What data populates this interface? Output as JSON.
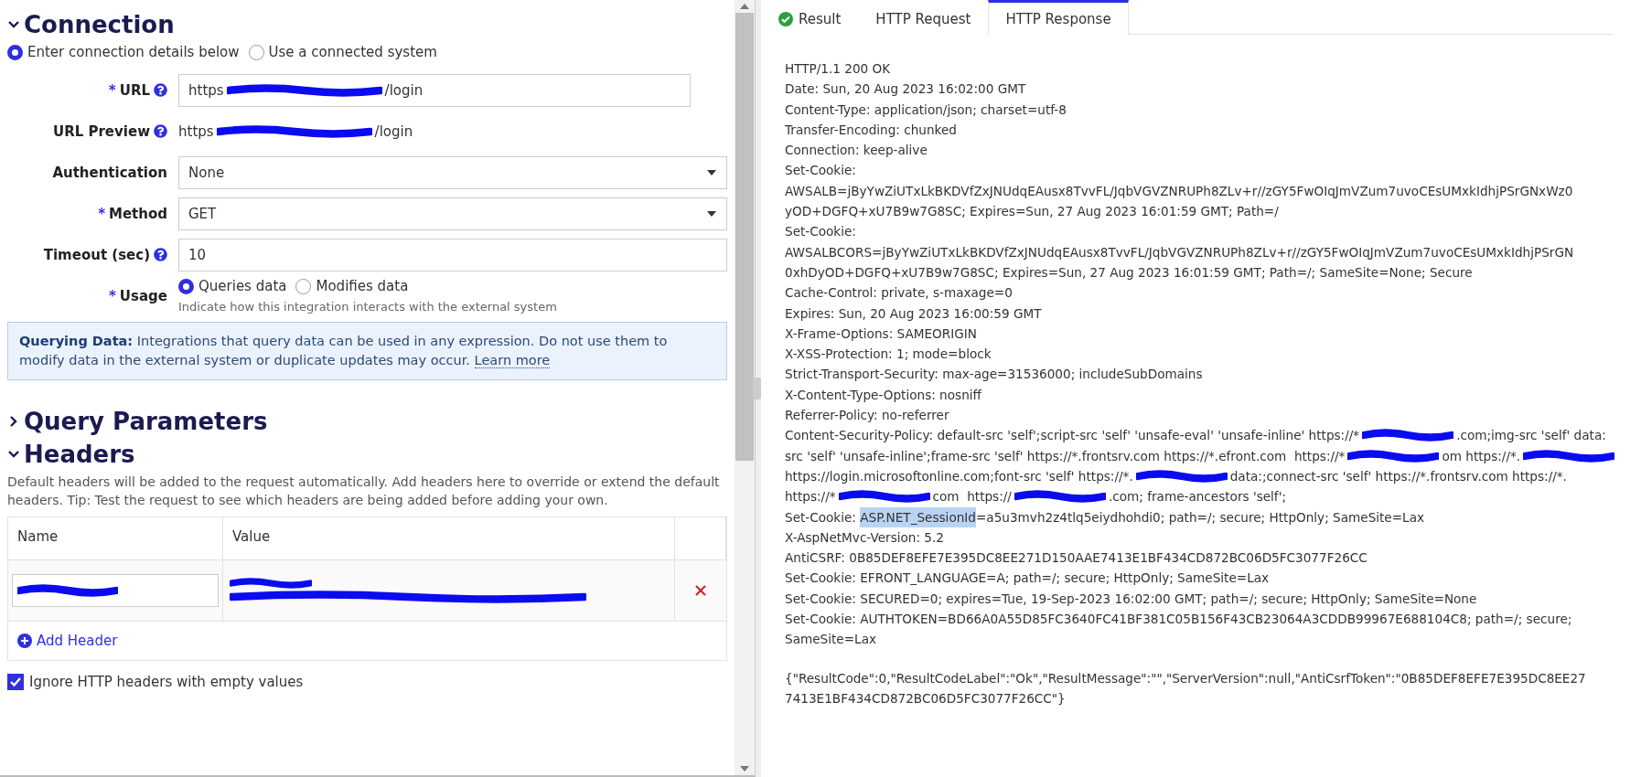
{
  "connection": {
    "title": "Connection",
    "expanded": true,
    "source_options": [
      {
        "label": "Enter connection details below",
        "selected": true
      },
      {
        "label": "Use a connected system",
        "selected": false
      }
    ],
    "fields": [
      {
        "kind": "input",
        "label": "URL",
        "required_mark": "*",
        "help": true,
        "value_parts": [
          "https",
          "/login"
        ]
      },
      {
        "kind": "text",
        "label": "URL Preview",
        "help": true,
        "value_parts": [
          "https",
          "/login"
        ]
      },
      {
        "kind": "select",
        "label": "Authentication",
        "help": false,
        "value": "None"
      },
      {
        "kind": "select",
        "label": "Method",
        "required_mark": "*",
        "help": false,
        "value": "GET"
      },
      {
        "kind": "input",
        "label": "Timeout (sec)",
        "help": true,
        "value_parts": [
          "10"
        ]
      },
      {
        "kind": "radio",
        "label": "Usage",
        "required_mark": "*",
        "help": false,
        "options": [
          {
            "label": "Queries data",
            "selected": true
          },
          {
            "label": "Modifies data",
            "selected": false
          }
        ],
        "hint": "Indicate how this integration interacts with the external system"
      }
    ],
    "info": {
      "title": "Querying Data:",
      "text": "Integrations that query data can be used in any expression. Do not use them to modify data in the external system or duplicate updates may occur.",
      "link": "Learn more"
    }
  },
  "query_parameters": {
    "title": "Query Parameters",
    "expanded": false
  },
  "headers": {
    "title": "Headers",
    "expanded": true,
    "description": "Default headers will be added to the request automatically. Add headers here to override or extend the default headers. Tip: Test the request to see which headers are being added before adding your own.",
    "columns": [
      "Name",
      "Value"
    ],
    "rows": [
      {
        "kind": "redacted"
      }
    ],
    "add_button": "Add Header",
    "ignore_empty": {
      "label": "Ignore HTTP headers with empty values",
      "checked": true
    }
  },
  "response": {
    "tabs": [
      {
        "label": "Result",
        "selected": false,
        "success": true
      },
      {
        "label": "HTTP Request",
        "selected": false
      },
      {
        "label": "HTTP Response",
        "selected": true
      }
    ],
    "lines": [
      "HTTP/1.1 200 OK",
      "Date: Sun, 20 Aug 2023 16:02:00 GMT",
      "Content-Type: application/json; charset=utf-8",
      "Transfer-Encoding: chunked",
      "Connection: keep-alive",
      "Set-Cookie:",
      "AWSALB=jByYwZiUTxLkBKDVfZxJNUdqEAusx8TvvFL/JqbVGVZNRUPh8ZLv+r//zGY5FwOIqJmVZum7uvoCEsUMxkIdhjPSrGNxWz0",
      "yOD+DGFQ+xU7B9w7G8SC; Expires=Sun, 27 Aug 2023 16:01:59 GMT; Path=/",
      "Set-Cookie:",
      "AWSALBCORS=jByYwZiUTxLkBKDVfZxJNUdqEAusx8TvvFL/JqbVGVZNRUPh8ZLv+r//zGY5FwOIqJmVZum7uvoCEsUMxkIdhjPSrGN",
      "0xhDyOD+DGFQ+xU7B9w7G8SC; Expires=Sun, 27 Aug 2023 16:01:59 GMT; Path=/; SameSite=None; Secure",
      "Cache-Control: private, s-maxage=0",
      "Expires: Sun, 20 Aug 2023 16:00:59 GMT",
      "X-Frame-Options: SAMEORIGIN",
      "X-XSS-Protection: 1; mode=block",
      "Strict-Transport-Security: max-age=31536000; includeSubDomains",
      "X-Content-Type-Options: nosniff",
      "Referrer-Policy: no-referrer",
      {
        "parts": [
          "Content-Security-Policy: default-src 'self';script-src 'self' 'unsafe-eval' 'unsafe-inline' https://*",
          {
            "kind": "redaction"
          },
          ".com;img-src 'self' data:"
        ]
      },
      {
        "parts": [
          "src 'self' 'unsafe-inline';frame-src 'self' https://*.frontsrv.com https://*.efront.com  https://*",
          {
            "kind": "redaction"
          },
          "om https://*.",
          {
            "kind": "redaction"
          }
        ]
      },
      {
        "parts": [
          "https://login.microsoftonline.com;font-src 'self' https://*.",
          {
            "kind": "redaction"
          },
          "data:;connect-src 'self' https://*.frontsrv.com https://*."
        ]
      },
      {
        "parts": [
          "https://*",
          {
            "kind": "redaction"
          },
          "com  https://",
          {
            "kind": "redaction"
          },
          ".com; frame-ancestors 'self';"
        ]
      },
      {
        "parts": [
          "Set-Cookie: ",
          {
            "kind": "highlight",
            "text": "ASP.NET_SessionId"
          },
          "=a5u3mvh2z4tlq5eiydhohdi0; path=/; secure; HttpOnly; SameSite=Lax"
        ]
      },
      "X-AspNetMvc-Version: 5.2",
      "AntiCSRF: 0B85DEF8EFE7E395DC8EE271D150AAE7413E1BF434CD872BC06D5FC3077F26CC",
      "Set-Cookie: EFRONT_LANGUAGE=A; path=/; secure; HttpOnly; SameSite=Lax",
      "Set-Cookie: SECURED=0; expires=Tue, 19-Sep-2023 16:02:00 GMT; path=/; secure; HttpOnly; SameSite=None",
      "Set-Cookie: AUTHTOKEN=BD66A0A55D85FC3640FC41BF381C05B156F43CB23064A3CDDB99967E688104C8; path=/; secure;",
      "SameSite=Lax"
    ],
    "body_lines": [
      "{\"ResultCode\":0,\"ResultCodeLabel\":\"Ok\",\"ResultMessage\":\"\",\"ServerVersion\":null,\"AntiCsrfToken\":\"0B85DEF8EFE7E395DC8EE27",
      "7413E1BF434CD872BC06D5FC3077F26CC\"}"
    ]
  }
}
